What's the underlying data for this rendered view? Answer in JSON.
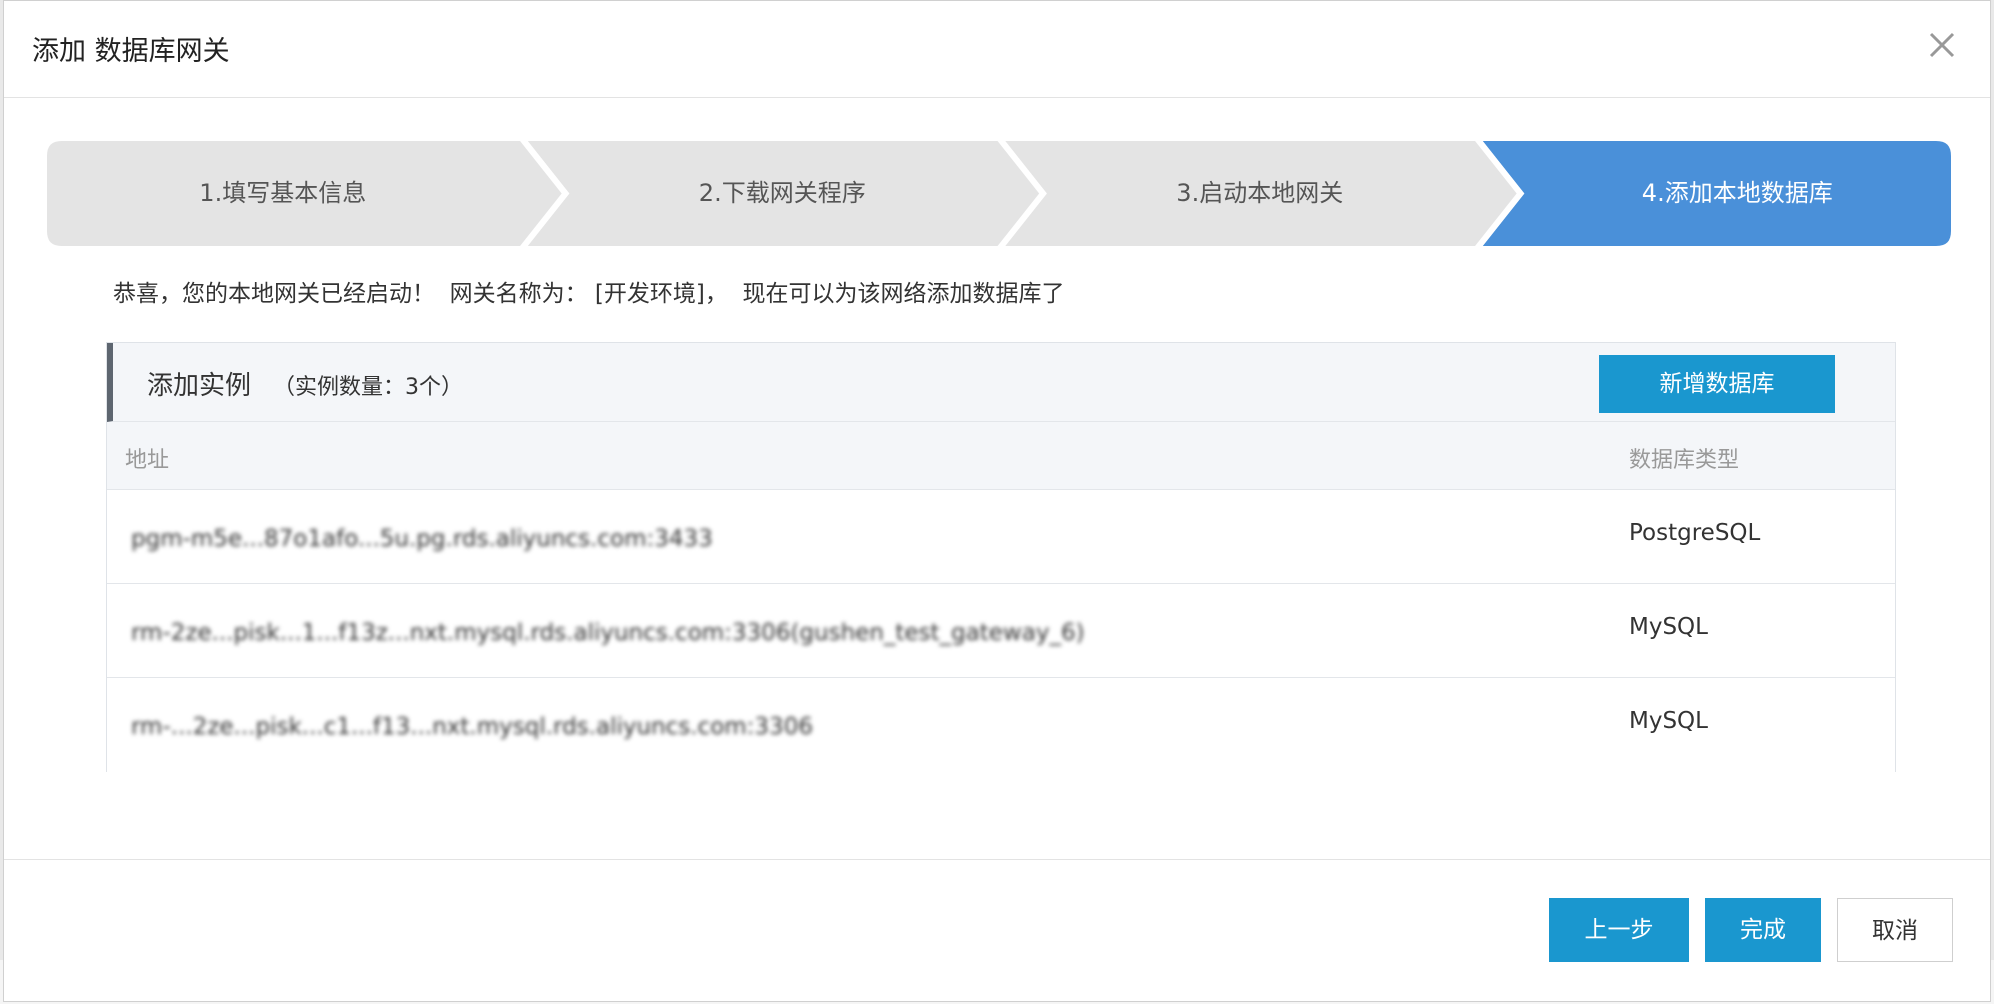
{
  "dialog": {
    "title": "添加 数据库网关",
    "close_label": "×"
  },
  "steps": [
    {
      "label": "1.填写基本信息",
      "active": false
    },
    {
      "label": "2.下载网关程序",
      "active": false
    },
    {
      "label": "3.启动本地网关",
      "active": false
    },
    {
      "label": "4.添加本地数据库",
      "active": true
    }
  ],
  "message": "恭喜，您的本地网关已经启动！  网关名称为： [开发环境]，  现在可以为该网络添加数据库了",
  "panel": {
    "title": "添加实例",
    "count_text": "（实例数量：3个）",
    "add_button": "新增数据库",
    "columns": {
      "address": "地址",
      "type": "数据库类型"
    },
    "rows": [
      {
        "address": "pgm-m5e...87o1afo...5u.pg.rds.aliyuncs.com:3433",
        "type": "PostgreSQL"
      },
      {
        "address": "rm-2ze...pisk...1...f13z...nxt.mysql.rds.aliyuncs.com:3306(gushen_test_gateway_6)",
        "type": "MySQL"
      },
      {
        "address": "rm-...2ze...pisk...c1...f13...nxt.mysql.rds.aliyuncs.com:3306",
        "type": "MySQL"
      }
    ]
  },
  "footer": {
    "prev": "上一步",
    "finish": "完成",
    "cancel": "取消"
  },
  "colors": {
    "step_active": "#4a90d9",
    "step_inactive": "#e4e4e4",
    "primary_button": "#1a97cf"
  }
}
